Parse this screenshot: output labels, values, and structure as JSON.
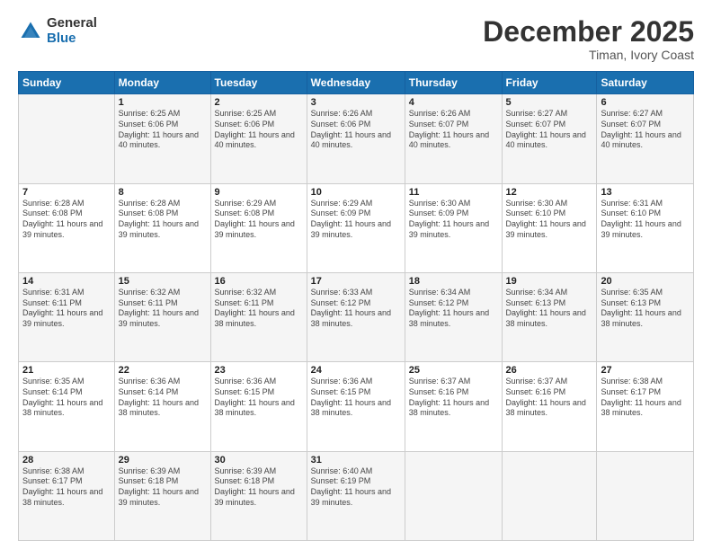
{
  "logo": {
    "general": "General",
    "blue": "Blue"
  },
  "header": {
    "month": "December 2025",
    "location": "Timan, Ivory Coast"
  },
  "days_of_week": [
    "Sunday",
    "Monday",
    "Tuesday",
    "Wednesday",
    "Thursday",
    "Friday",
    "Saturday"
  ],
  "weeks": [
    [
      {
        "day": "",
        "info": ""
      },
      {
        "day": "1",
        "info": "Sunrise: 6:25 AM\nSunset: 6:06 PM\nDaylight: 11 hours and 40 minutes."
      },
      {
        "day": "2",
        "info": "Sunrise: 6:25 AM\nSunset: 6:06 PM\nDaylight: 11 hours and 40 minutes."
      },
      {
        "day": "3",
        "info": "Sunrise: 6:26 AM\nSunset: 6:06 PM\nDaylight: 11 hours and 40 minutes."
      },
      {
        "day": "4",
        "info": "Sunrise: 6:26 AM\nSunset: 6:07 PM\nDaylight: 11 hours and 40 minutes."
      },
      {
        "day": "5",
        "info": "Sunrise: 6:27 AM\nSunset: 6:07 PM\nDaylight: 11 hours and 40 minutes."
      },
      {
        "day": "6",
        "info": "Sunrise: 6:27 AM\nSunset: 6:07 PM\nDaylight: 11 hours and 40 minutes."
      }
    ],
    [
      {
        "day": "7",
        "info": "Sunrise: 6:28 AM\nSunset: 6:08 PM\nDaylight: 11 hours and 39 minutes."
      },
      {
        "day": "8",
        "info": "Sunrise: 6:28 AM\nSunset: 6:08 PM\nDaylight: 11 hours and 39 minutes."
      },
      {
        "day": "9",
        "info": "Sunrise: 6:29 AM\nSunset: 6:08 PM\nDaylight: 11 hours and 39 minutes."
      },
      {
        "day": "10",
        "info": "Sunrise: 6:29 AM\nSunset: 6:09 PM\nDaylight: 11 hours and 39 minutes."
      },
      {
        "day": "11",
        "info": "Sunrise: 6:30 AM\nSunset: 6:09 PM\nDaylight: 11 hours and 39 minutes."
      },
      {
        "day": "12",
        "info": "Sunrise: 6:30 AM\nSunset: 6:10 PM\nDaylight: 11 hours and 39 minutes."
      },
      {
        "day": "13",
        "info": "Sunrise: 6:31 AM\nSunset: 6:10 PM\nDaylight: 11 hours and 39 minutes."
      }
    ],
    [
      {
        "day": "14",
        "info": "Sunrise: 6:31 AM\nSunset: 6:11 PM\nDaylight: 11 hours and 39 minutes."
      },
      {
        "day": "15",
        "info": "Sunrise: 6:32 AM\nSunset: 6:11 PM\nDaylight: 11 hours and 39 minutes."
      },
      {
        "day": "16",
        "info": "Sunrise: 6:32 AM\nSunset: 6:11 PM\nDaylight: 11 hours and 38 minutes."
      },
      {
        "day": "17",
        "info": "Sunrise: 6:33 AM\nSunset: 6:12 PM\nDaylight: 11 hours and 38 minutes."
      },
      {
        "day": "18",
        "info": "Sunrise: 6:34 AM\nSunset: 6:12 PM\nDaylight: 11 hours and 38 minutes."
      },
      {
        "day": "19",
        "info": "Sunrise: 6:34 AM\nSunset: 6:13 PM\nDaylight: 11 hours and 38 minutes."
      },
      {
        "day": "20",
        "info": "Sunrise: 6:35 AM\nSunset: 6:13 PM\nDaylight: 11 hours and 38 minutes."
      }
    ],
    [
      {
        "day": "21",
        "info": "Sunrise: 6:35 AM\nSunset: 6:14 PM\nDaylight: 11 hours and 38 minutes."
      },
      {
        "day": "22",
        "info": "Sunrise: 6:36 AM\nSunset: 6:14 PM\nDaylight: 11 hours and 38 minutes."
      },
      {
        "day": "23",
        "info": "Sunrise: 6:36 AM\nSunset: 6:15 PM\nDaylight: 11 hours and 38 minutes."
      },
      {
        "day": "24",
        "info": "Sunrise: 6:36 AM\nSunset: 6:15 PM\nDaylight: 11 hours and 38 minutes."
      },
      {
        "day": "25",
        "info": "Sunrise: 6:37 AM\nSunset: 6:16 PM\nDaylight: 11 hours and 38 minutes."
      },
      {
        "day": "26",
        "info": "Sunrise: 6:37 AM\nSunset: 6:16 PM\nDaylight: 11 hours and 38 minutes."
      },
      {
        "day": "27",
        "info": "Sunrise: 6:38 AM\nSunset: 6:17 PM\nDaylight: 11 hours and 38 minutes."
      }
    ],
    [
      {
        "day": "28",
        "info": "Sunrise: 6:38 AM\nSunset: 6:17 PM\nDaylight: 11 hours and 38 minutes."
      },
      {
        "day": "29",
        "info": "Sunrise: 6:39 AM\nSunset: 6:18 PM\nDaylight: 11 hours and 39 minutes."
      },
      {
        "day": "30",
        "info": "Sunrise: 6:39 AM\nSunset: 6:18 PM\nDaylight: 11 hours and 39 minutes."
      },
      {
        "day": "31",
        "info": "Sunrise: 6:40 AM\nSunset: 6:19 PM\nDaylight: 11 hours and 39 minutes."
      },
      {
        "day": "",
        "info": ""
      },
      {
        "day": "",
        "info": ""
      },
      {
        "day": "",
        "info": ""
      }
    ]
  ]
}
